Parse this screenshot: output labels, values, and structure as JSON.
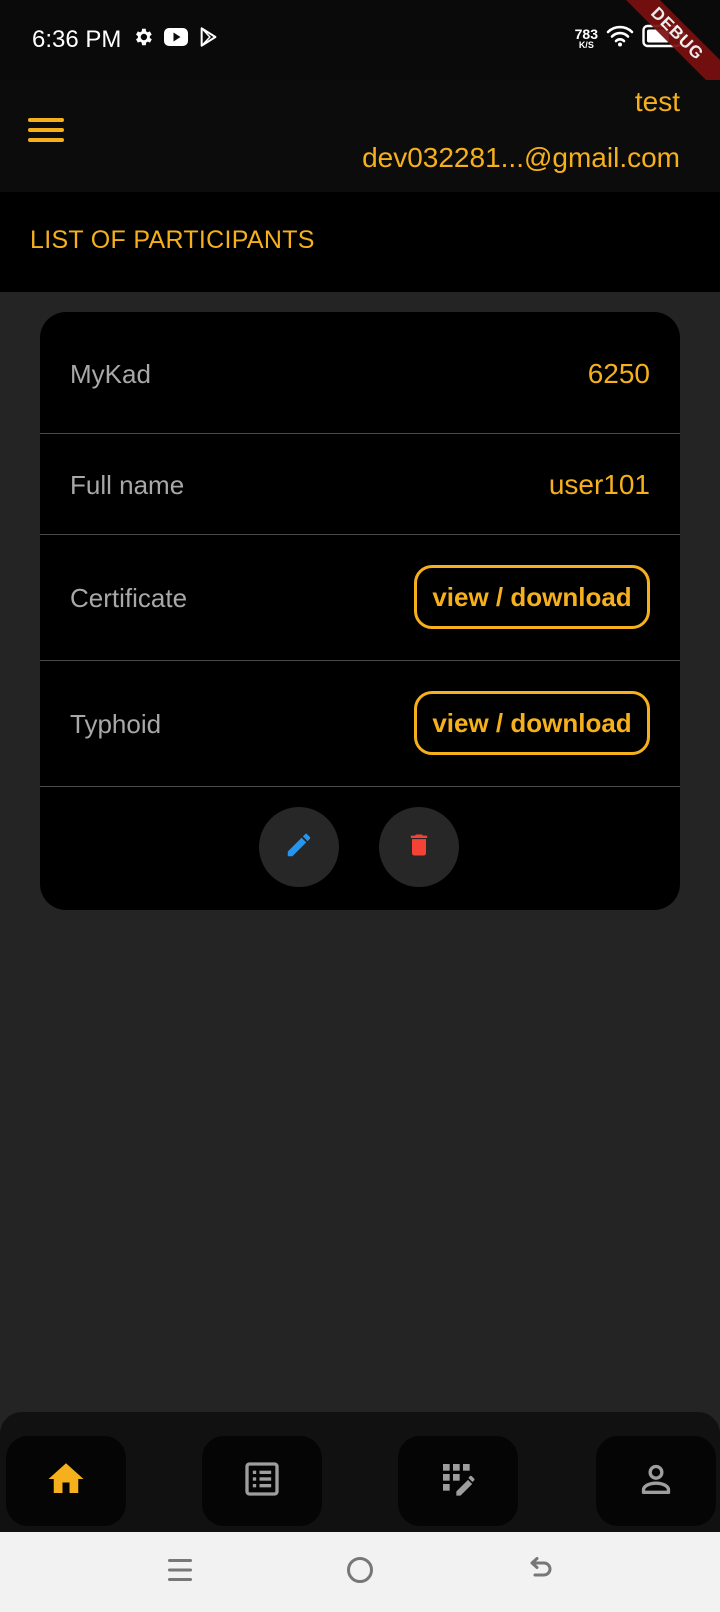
{
  "status_bar": {
    "time": "6:36 PM",
    "net_speed_value": "783",
    "net_speed_unit": "K/S",
    "left_icons": [
      "settings-icon",
      "youtube-icon",
      "play-store-icon"
    ],
    "right_icons": [
      "wifi-icon",
      "battery-icon"
    ]
  },
  "debug_banner": "DEBUG",
  "header": {
    "user_name": "test",
    "user_email": "dev032281...@gmail.com"
  },
  "page": {
    "title": "LIST OF PARTICIPANTS"
  },
  "participant": {
    "rows": [
      {
        "label": "MyKad",
        "value": "6250"
      },
      {
        "label": "Full name",
        "value": "user101"
      },
      {
        "label": "Certificate",
        "button": "view / download"
      },
      {
        "label": "Typhoid",
        "button": "view / download"
      }
    ]
  },
  "bottom_nav": {
    "items": [
      "home-icon",
      "list-icon",
      "edit-grid-icon",
      "profile-icon"
    ],
    "active": "home-icon"
  },
  "system_nav": [
    "recents-icon",
    "home-circle-icon",
    "back-icon"
  ],
  "colors": {
    "accent": "#f5b01b",
    "background": "#242424",
    "card": "#000000",
    "edit": "#2196f3",
    "delete": "#f44336",
    "inactive_icon": "#9e9e9e"
  }
}
